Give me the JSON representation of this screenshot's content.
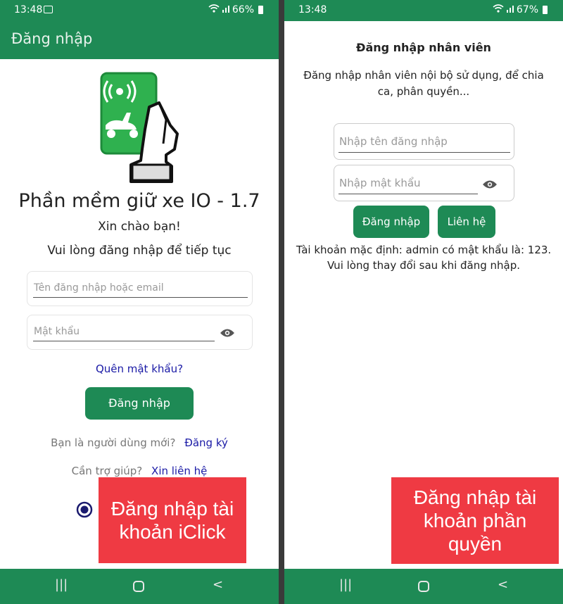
{
  "left": {
    "status": {
      "time": "13:48",
      "battery": "66%"
    },
    "appbar_title": "Đăng nhập",
    "app_title": "Phần mềm giữ xe IO - 1.7",
    "greeting": "Xin chào bạn!",
    "instruction": "Vui lòng đăng nhập để tiếp tục",
    "username_placeholder": "Tên đăng nhập hoặc email",
    "password_placeholder": "Mật khẩu",
    "forgot_password": "Quên mật khẩu?",
    "login_button": "Đăng nhập",
    "new_user_text": "Bạn là người dùng mới?",
    "register_link": "Đăng ký",
    "help_text": "Cần trợ giúp?",
    "contact_link": "Xin liên hệ",
    "overlay_text": "Đăng nhập tài khoản iClick"
  },
  "right": {
    "status": {
      "time": "13:48",
      "battery": "67%"
    },
    "title": "Đăng nhập nhân viên",
    "description": "Đăng nhập nhân viên nội bộ sử dụng, để chia ca, phân quyền...",
    "username_placeholder": "Nhập tên đăng nhập",
    "password_placeholder": "Nhập mật khẩu",
    "login_button": "Đăng nhập",
    "contact_button": "Liên hệ",
    "default_account_note": "Tài khoản mặc định: admin có mật khẩu là: 123. Vui lòng thay đổi sau khi đăng nhập.",
    "overlay_text": "Đăng nhập tài khoản phần quyền"
  },
  "colors": {
    "primary": "#1e8a55",
    "link": "#1a1aa6",
    "overlay": "#ef3a43"
  },
  "icons": [
    "gallery-icon",
    "wifi-icon",
    "signal-icon",
    "battery-icon",
    "eye-icon",
    "radio-selected-icon",
    "recent-apps-icon",
    "home-icon",
    "back-icon",
    "parking-logo-icon"
  ]
}
